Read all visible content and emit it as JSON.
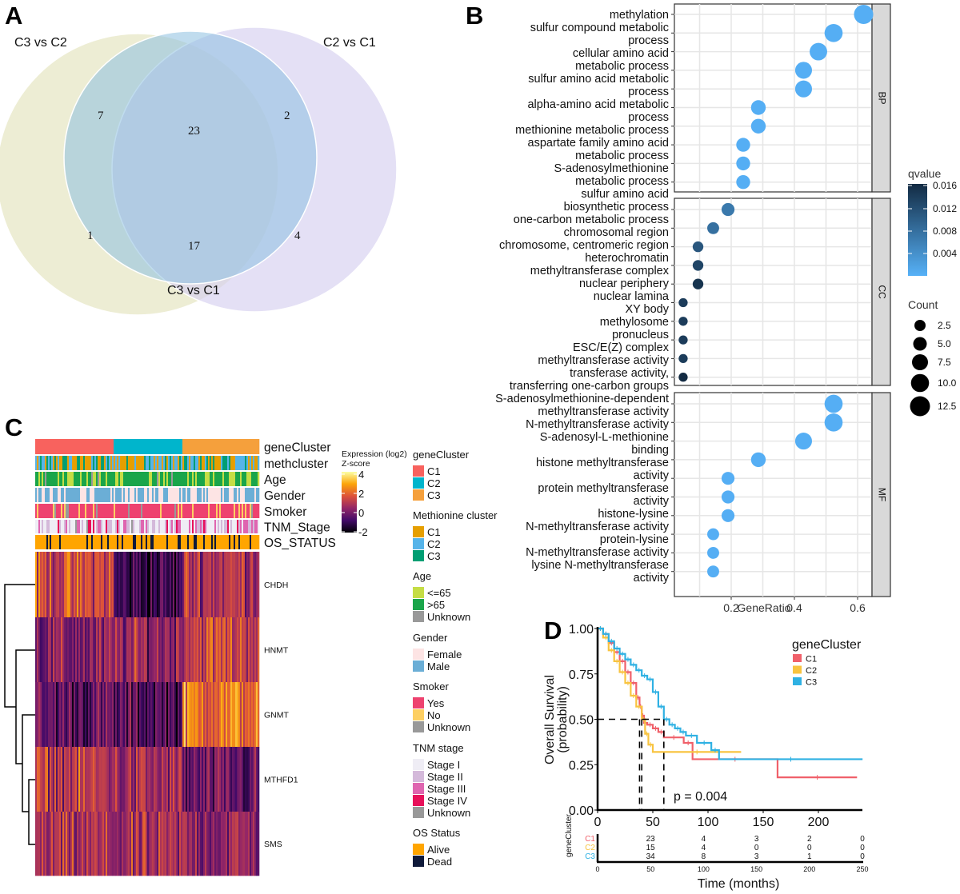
{
  "panels": {
    "a": "A",
    "b": "B",
    "c": "C",
    "d": "D"
  },
  "chart_data": [
    {
      "type": "venn",
      "sets": [
        "C3 vs C2",
        "C2 vs C1",
        "C3 vs C1"
      ],
      "regions": [
        {
          "sets": [
            "C3 vs C2",
            "C3 vs C1"
          ],
          "count": "7"
        },
        {
          "sets": [
            "C3 vs C2",
            "C2 vs C1",
            "C3 vs C1"
          ],
          "count": "23"
        },
        {
          "sets": [
            "C2 vs C1",
            "C3 vs C1"
          ],
          "count": "2"
        },
        {
          "sets": [
            "C3 vs C2"
          ],
          "count": "1"
        },
        {
          "sets": [
            "C3 vs C2",
            "C2 vs C1"
          ],
          "count": "17"
        },
        {
          "sets": [
            "C2 vs C1"
          ],
          "count": "4"
        }
      ],
      "colors": {
        "C3 vs C2": "#e3e3bd",
        "C2 vs C1": "#d6cff0",
        "C3 vs C1": "#9cc6e2"
      }
    },
    {
      "type": "scatter",
      "xlabel": "GeneRatio",
      "xlim": [
        0.02,
        0.65
      ],
      "xticks": [
        "0.2",
        "0.4",
        "0.6"
      ],
      "grid": true,
      "facets": [
        {
          "name": "BP",
          "terms": [
            {
              "lines": [
                "methylation"
              ],
              "gene_ratio": 0.619,
              "count": 13,
              "qvalue": 0.0008
            },
            {
              "lines": [
                "sulfur compound metabolic",
                "process"
              ],
              "gene_ratio": 0.524,
              "count": 11,
              "qvalue": 0.0008
            },
            {
              "lines": [
                "cellular amino acid",
                "metabolic process"
              ],
              "gene_ratio": 0.476,
              "count": 10,
              "qvalue": 0.0008
            },
            {
              "lines": [
                "sulfur amino acid metabolic",
                "process"
              ],
              "gene_ratio": 0.429,
              "count": 9,
              "qvalue": 0.0008
            },
            {
              "lines": [
                "alpha-amino acid metabolic",
                "process"
              ],
              "gene_ratio": 0.429,
              "count": 9,
              "qvalue": 0.0008
            },
            {
              "lines": [
                "methionine metabolic process"
              ],
              "gene_ratio": 0.286,
              "count": 6,
              "qvalue": 0.0008
            },
            {
              "lines": [
                "aspartate family amino acid",
                "metabolic process"
              ],
              "gene_ratio": 0.286,
              "count": 6,
              "qvalue": 0.0008
            },
            {
              "lines": [
                "S-adenosylmethionine",
                "metabolic process"
              ],
              "gene_ratio": 0.238,
              "count": 5,
              "qvalue": 0.0008
            },
            {
              "lines": [
                "sulfur amino acid",
                "biosynthetic process"
              ],
              "gene_ratio": 0.238,
              "count": 5,
              "qvalue": 0.0008
            },
            {
              "lines": [
                "one-carbon metabolic process"
              ],
              "gene_ratio": 0.238,
              "count": 5,
              "qvalue": 0.0008
            }
          ]
        },
        {
          "name": "CC",
          "terms": [
            {
              "lines": [
                "chromosomal region"
              ],
              "gene_ratio": 0.19,
              "count": 4,
              "qvalue": 0.007
            },
            {
              "lines": [
                "chromosome, centromeric region"
              ],
              "gene_ratio": 0.143,
              "count": 3,
              "qvalue": 0.008
            },
            {
              "lines": [
                "heterochromatin"
              ],
              "gene_ratio": 0.095,
              "count": 2,
              "qvalue": 0.011
            },
            {
              "lines": [
                "methyltransferase complex"
              ],
              "gene_ratio": 0.095,
              "count": 2,
              "qvalue": 0.013
            },
            {
              "lines": [
                "nuclear periphery"
              ],
              "gene_ratio": 0.095,
              "count": 2,
              "qvalue": 0.015
            },
            {
              "lines": [
                "nuclear lamina"
              ],
              "gene_ratio": 0.048,
              "count": 1,
              "qvalue": 0.014
            },
            {
              "lines": [
                "XY body"
              ],
              "gene_ratio": 0.048,
              "count": 1,
              "qvalue": 0.014
            },
            {
              "lines": [
                "methylosome"
              ],
              "gene_ratio": 0.048,
              "count": 1,
              "qvalue": 0.014
            },
            {
              "lines": [
                "pronucleus"
              ],
              "gene_ratio": 0.048,
              "count": 1,
              "qvalue": 0.014
            },
            {
              "lines": [
                "ESC/E(Z) complex"
              ],
              "gene_ratio": 0.048,
              "count": 1,
              "qvalue": 0.016
            }
          ]
        },
        {
          "name": "MF",
          "terms": [
            {
              "lines": [
                "methyltransferase activity"
              ],
              "gene_ratio": 0.524,
              "count": 11,
              "qvalue": 0.0008
            },
            {
              "lines": [
                "transferase activity,",
                "transferring one-carbon groups"
              ],
              "gene_ratio": 0.524,
              "count": 11,
              "qvalue": 0.0008
            },
            {
              "lines": [
                "S-adenosylmethionine-dependent",
                "methyltransferase activity"
              ],
              "gene_ratio": 0.429,
              "count": 9,
              "qvalue": 0.0008
            },
            {
              "lines": [
                "N-methyltransferase activity"
              ],
              "gene_ratio": 0.286,
              "count": 6,
              "qvalue": 0.0008
            },
            {
              "lines": [
                "S-adenosyl-L-methionine",
                "binding"
              ],
              "gene_ratio": 0.19,
              "count": 4,
              "qvalue": 0.0008
            },
            {
              "lines": [
                "histone methyltransferase",
                "activity"
              ],
              "gene_ratio": 0.19,
              "count": 4,
              "qvalue": 0.0008
            },
            {
              "lines": [
                "protein methyltransferase",
                "activity"
              ],
              "gene_ratio": 0.19,
              "count": 4,
              "qvalue": 0.0008
            },
            {
              "lines": [
                "histone-lysine",
                "N-methyltransferase activity"
              ],
              "gene_ratio": 0.143,
              "count": 3,
              "qvalue": 0.0008
            },
            {
              "lines": [
                "protein-lysine",
                "N-methyltransferase activity"
              ],
              "gene_ratio": 0.143,
              "count": 3,
              "qvalue": 0.0008
            },
            {
              "lines": [
                "lysine N-methyltransferase",
                "activity"
              ],
              "gene_ratio": 0.143,
              "count": 3,
              "qvalue": 0.0008
            }
          ]
        }
      ],
      "legend_color": {
        "title": "qvalue",
        "ticks": [
          "0.016",
          "0.012",
          "0.008",
          "0.004"
        ],
        "low": "#56b1f7",
        "high": "#132b43"
      },
      "legend_size": {
        "title": "Count",
        "ticks": [
          "2.5",
          "5.0",
          "7.5",
          "10.0",
          "12.5"
        ]
      }
    },
    {
      "type": "heatmap",
      "genes": [
        "CHDH",
        "HNMT",
        "GNMT",
        "MTHFD1",
        "SMS"
      ],
      "annotation_tracks": [
        "geneCluster",
        "methcluster",
        "Age",
        "Gender",
        "Smoker",
        "TNM_Stage",
        "OS_STATUS"
      ],
      "color_legend": {
        "title1": "Expression (log2)",
        "title2": "Z-score",
        "ticks": [
          "4",
          "2",
          "0",
          "-2"
        ]
      },
      "legends": [
        {
          "title": "geneCluster",
          "items": [
            {
              "label": "C1",
              "color": "#f8625e"
            },
            {
              "label": "C2",
              "color": "#00b5cc"
            },
            {
              "label": "C3",
              "color": "#f5a03c"
            }
          ]
        },
        {
          "title": "Methionine cluster",
          "items": [
            {
              "label": "C1",
              "color": "#e69f00"
            },
            {
              "label": "C2",
              "color": "#56b4e9"
            },
            {
              "label": "C3",
              "color": "#009e73"
            }
          ]
        },
        {
          "title": "Age",
          "items": [
            {
              "label": "<=65",
              "color": "#c5dd45"
            },
            {
              "label": ">65",
              "color": "#1aa54a"
            },
            {
              "label": "Unknown",
              "color": "#999999"
            }
          ]
        },
        {
          "title": "Gender",
          "items": [
            {
              "label": "Female",
              "color": "#fde4e4"
            },
            {
              "label": "Male",
              "color": "#6baed6"
            }
          ]
        },
        {
          "title": "Smoker",
          "items": [
            {
              "label": "Yes",
              "color": "#ee426f"
            },
            {
              "label": "No",
              "color": "#fdcf62"
            },
            {
              "label": "Unknown",
              "color": "#999999"
            }
          ]
        },
        {
          "title": "TNM stage",
          "items": [
            {
              "label": "Stage I",
              "color": "#efedf5"
            },
            {
              "label": "Stage II",
              "color": "#d4b9da"
            },
            {
              "label": "Stage III",
              "color": "#df65b0"
            },
            {
              "label": "Stage IV",
              "color": "#e7105a"
            },
            {
              "label": "Unknown",
              "color": "#999999"
            }
          ]
        },
        {
          "title": "OS Status",
          "items": [
            {
              "label": "Alive",
              "color": "#ffa500"
            },
            {
              "label": "Dead",
              "color": "#0f1a3a"
            }
          ]
        }
      ]
    },
    {
      "type": "line",
      "ylabel": [
        "Overall Survival",
        "(probability)"
      ],
      "xlabel": "Time (months)",
      "xlim": [
        0,
        240
      ],
      "ylim": [
        0,
        1
      ],
      "xticks": [
        "0",
        "50",
        "100",
        "150",
        "200"
      ],
      "yticks": [
        "1.00",
        "0.75",
        "0.50",
        "0.25",
        "0.00"
      ],
      "legend_title": "geneCluster",
      "p_value": "p = 0.004",
      "median_times": [
        38,
        40,
        60
      ],
      "series": [
        {
          "name": "C1",
          "color": "#f0606a",
          "x": [
            0,
            5,
            10,
            15,
            20,
            25,
            30,
            35,
            38,
            40,
            42,
            45,
            50,
            55,
            60,
            78,
            86,
            163,
            235
          ],
          "y": [
            1,
            0.97,
            0.92,
            0.87,
            0.82,
            0.76,
            0.7,
            0.62,
            0.57,
            0.52,
            0.48,
            0.47,
            0.45,
            0.43,
            0.4,
            0.37,
            0.28,
            0.18,
            0.18
          ]
        },
        {
          "name": "C2",
          "color": "#f8c440",
          "x": [
            0,
            5,
            10,
            15,
            20,
            25,
            30,
            35,
            40,
            43,
            46,
            50,
            130
          ],
          "y": [
            1,
            0.95,
            0.88,
            0.82,
            0.76,
            0.7,
            0.63,
            0.57,
            0.5,
            0.42,
            0.36,
            0.32,
            0.32
          ]
        },
        {
          "name": "C3",
          "color": "#2fb1e3",
          "x": [
            0,
            5,
            10,
            15,
            20,
            25,
            30,
            35,
            40,
            45,
            50,
            55,
            60,
            65,
            70,
            75,
            80,
            90,
            103,
            110,
            240
          ],
          "y": [
            1,
            0.97,
            0.93,
            0.89,
            0.86,
            0.83,
            0.8,
            0.77,
            0.74,
            0.72,
            0.65,
            0.57,
            0.5,
            0.47,
            0.45,
            0.43,
            0.41,
            0.37,
            0.33,
            0.28,
            0.28
          ]
        }
      ],
      "risk_table": {
        "title": "geneCluster",
        "times": [
          "0",
          "50",
          "100",
          "150",
          "200",
          "250"
        ],
        "rows": [
          {
            "name": "C1",
            "values": [
              "23",
              "4",
              "3",
              "2",
              "0"
            ]
          },
          {
            "name": "C2",
            "values": [
              "15",
              "4",
              "0",
              "0",
              "0"
            ]
          },
          {
            "name": "C3",
            "values": [
              "34",
              "8",
              "3",
              "1",
              "0"
            ]
          }
        ]
      }
    }
  ]
}
